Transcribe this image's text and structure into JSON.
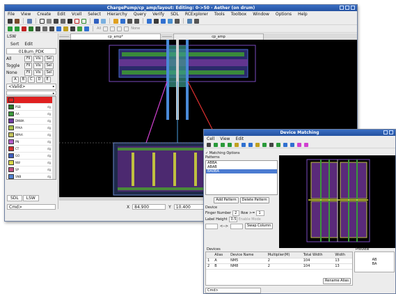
{
  "main": {
    "title": "ChargePump/cp_amp/layout: Editing: 0->50 - Aether (on drum)",
    "menus": [
      "File",
      "View",
      "Create",
      "Edit",
      "Vcell",
      "Select",
      "Hierarchy",
      "Query",
      "Verify",
      "SDL",
      "RCExplorer",
      "Tools",
      "Toolbox",
      "Window",
      "Options",
      "Help"
    ],
    "toolbar2_text": {
      "all": "All",
      "none": "None"
    },
    "lsw": {
      "title": "LSW",
      "sort": "Sort",
      "edit": "Edit",
      "tech": "018um_PDK",
      "rows": [
        {
          "label": "All",
          "b1": "Fil",
          "b2": "Vis",
          "b3": "Sel"
        },
        {
          "label": "Toggle",
          "b1": "Fil",
          "b2": "Vis",
          "b3": "Sel"
        },
        {
          "label": "None",
          "b1": "Fil",
          "b2": "Vis",
          "b3": "Sel"
        }
      ],
      "mode_buttons": [
        "A",
        "B",
        "C",
        "D",
        "E"
      ],
      "valid": "<Valid>",
      "layers": [
        {
          "name": "",
          "purpose": "",
          "color": "#e02020"
        },
        {
          "name": "PSB",
          "purpose": "dg",
          "color": "#2a7a2a"
        },
        {
          "name": "AA",
          "purpose": "dg",
          "color": "#3b9a3b"
        },
        {
          "name": "DNWA",
          "purpose": "dg",
          "color": "#6f3ba0"
        },
        {
          "name": "PPAA",
          "purpose": "dg",
          "color": "#a8c04a"
        },
        {
          "name": "NPAA",
          "purpose": "dg",
          "color": "#c2c25a"
        },
        {
          "name": "PN",
          "purpose": "dg",
          "color": "#b65fcb"
        },
        {
          "name": "CT",
          "purpose": "dg",
          "color": "#d03030"
        },
        {
          "name": "GO",
          "purpose": "dg",
          "color": "#4060c0"
        },
        {
          "name": "NW",
          "purpose": "dg",
          "color": "#d8d848"
        },
        {
          "name": "SP",
          "purpose": "dg",
          "color": "#c05080"
        },
        {
          "name": "SNB",
          "purpose": "dg",
          "color": "#5080d0"
        }
      ],
      "bottom_tabs": [
        "SDL",
        "LSW"
      ]
    },
    "tabs": [
      "cp_amp*",
      "",
      "cp_amp"
    ],
    "status": {
      "cmd": "Cmd>",
      "x_label": "X",
      "x_value": "84.900",
      "y_label": "Y",
      "y_value": "10.400"
    }
  },
  "dialog": {
    "title": "Device Matching",
    "menus": [
      "Cell",
      "View",
      "Edit"
    ],
    "matching_options": "Matching Options",
    "patterns_label": "Patterns",
    "patterns": [
      "ABBA",
      "ABAB",
      "BA0BA"
    ],
    "add_pattern": "Add Pattern",
    "delete_pattern": "Delete Pattern",
    "device_label": "Device",
    "finger_number_label": "Finger Number",
    "finger_number": "2",
    "row_label": "Row >=",
    "row_value": "1",
    "label_height_label": "Label Height",
    "label_height": "0.5",
    "enable_mode": "Enable Mode",
    "arrow": "<-->",
    "swap_column": "Swap Column",
    "devices_label": "Devices",
    "preview_label": "Preview",
    "columns": [
      "",
      "Alias",
      "Device Name",
      "Multiplier(M)",
      "Total Width",
      "Width"
    ],
    "rows": [
      [
        "1",
        "A",
        "NM5",
        "2",
        "104",
        "13"
      ],
      [
        "2",
        "B",
        "NM8",
        "2",
        "104",
        "13"
      ]
    ],
    "preview_lines": [
      "AB",
      "BA"
    ],
    "rename_alias": "Rename Alias",
    "cmd": "Cmd>"
  },
  "colors": {
    "title_blue": "#2f5fb5",
    "canvas_bg": "#000000"
  }
}
